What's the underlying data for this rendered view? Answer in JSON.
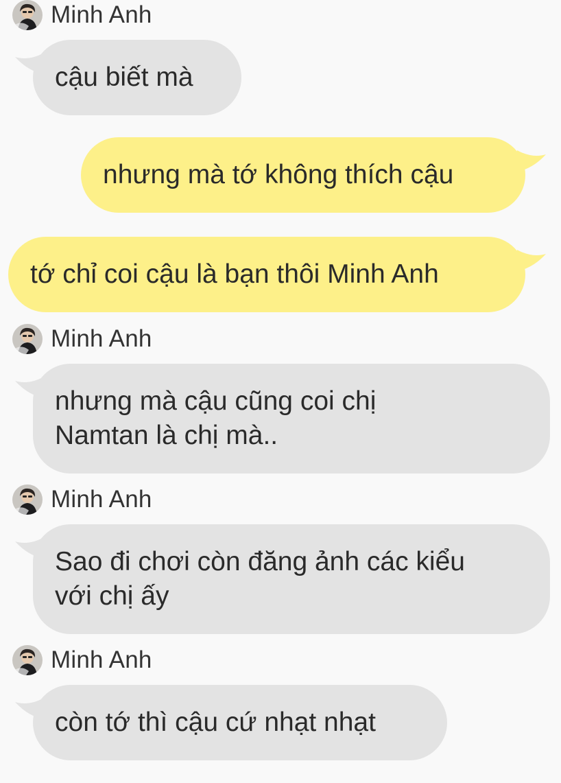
{
  "contact": {
    "name": "Minh Anh",
    "avatar_icon": "user-avatar-photo"
  },
  "colors": {
    "background": "#f9f9f9",
    "incoming_bubble": "#e3e3e3",
    "outgoing_bubble": "#fdf089",
    "text": "#2a2a2a"
  },
  "messages": [
    {
      "from": "contact",
      "text": "cậu biết mà"
    },
    {
      "from": "me",
      "text": "nhưng mà tớ không thích cậu"
    },
    {
      "from": "me",
      "text": "tớ chỉ coi cậu là bạn thôi Minh Anh"
    },
    {
      "from": "contact",
      "text": "nhưng mà cậu cũng coi chị\nNamtan là chị mà.."
    },
    {
      "from": "contact",
      "text": "Sao đi chơi còn đăng ảnh các kiểu\nvới chị ấy"
    },
    {
      "from": "contact",
      "text": "còn tớ thì cậu cứ nhạt nhạt"
    }
  ]
}
